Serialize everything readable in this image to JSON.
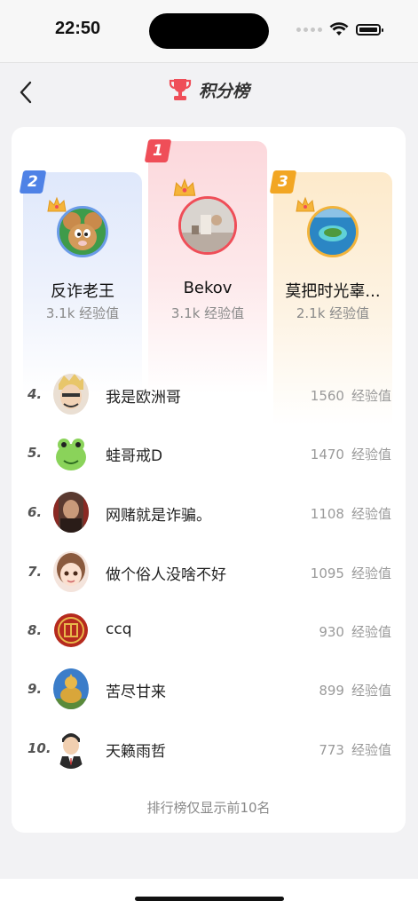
{
  "status": {
    "time": "22:50"
  },
  "nav": {
    "title": "积分榜"
  },
  "podium": [
    {
      "rank": "2",
      "name": "反诈老王",
      "score": "3.1k 经验值",
      "rank_color": "#4f82e6",
      "avatar": "cartoon-mouse-avatar"
    },
    {
      "rank": "1",
      "name": "Bekov",
      "score": "3.1k 经验值",
      "rank_color": "#ef4e58",
      "avatar": "room-photo-avatar"
    },
    {
      "rank": "3",
      "name": "莫把时光辜...",
      "score": "2.1k 经验值",
      "rank_color": "#f2a623",
      "avatar": "island-photo-avatar"
    }
  ],
  "ranking": [
    {
      "rank": "4.",
      "name": "我是欧洲哥",
      "score": "1560",
      "unit": "经验值"
    },
    {
      "rank": "5.",
      "name": "蛙哥戒D",
      "score": "1470",
      "unit": "经验值"
    },
    {
      "rank": "6.",
      "name": "网赌就是诈骗。",
      "score": "1108",
      "unit": "经验值"
    },
    {
      "rank": "7.",
      "name": "做个俗人没啥不好",
      "score": "1095",
      "unit": "经验值"
    },
    {
      "rank": "8.",
      "name": "ccq",
      "score": "930",
      "unit": "经验值"
    },
    {
      "rank": "9.",
      "name": "苦尽甘来",
      "score": "899",
      "unit": "经验值"
    },
    {
      "rank": "10.",
      "name": "天籁雨哲",
      "score": "773",
      "unit": "经验值"
    }
  ],
  "footer": {
    "note": "排行榜仅显示前10名"
  },
  "colors": {
    "accent_red": "#ef4e58",
    "blue": "#4f82e6",
    "gold": "#f2a623"
  }
}
